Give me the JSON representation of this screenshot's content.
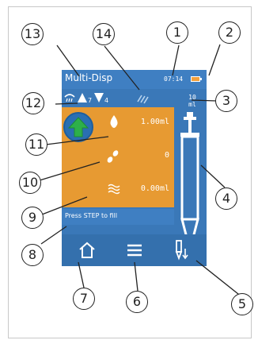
{
  "screen": {
    "title": "Multi-Disp",
    "time": "07:14",
    "up_count": "7",
    "down_count": "4",
    "volume_label_line1": "10",
    "volume_label_line2": "ml",
    "dispense_volume": "1.00ml",
    "step_count": "0",
    "remaining_volume": "0.00ml",
    "prompt": "Press STEP to fill"
  },
  "callouts": [
    "1",
    "2",
    "3",
    "4",
    "5",
    "6",
    "7",
    "8",
    "9",
    "10",
    "11",
    "12",
    "13",
    "14"
  ],
  "icons": {
    "battery": "battery-icon",
    "rain": "rain-icon",
    "arrow_up": "arrow-up-icon",
    "arrow_down": "arrow-down-icon",
    "sensor": "sensor-icon",
    "drop": "drop-icon",
    "pills": "pills-icon",
    "waves": "waves-icon",
    "home": "home-icon",
    "menu": "menu-icon",
    "fill": "fill-icon"
  },
  "colors": {
    "screen_blue": "#3a78b8",
    "panel_orange": "#e79a32",
    "indicator_green": "#2db04a"
  }
}
